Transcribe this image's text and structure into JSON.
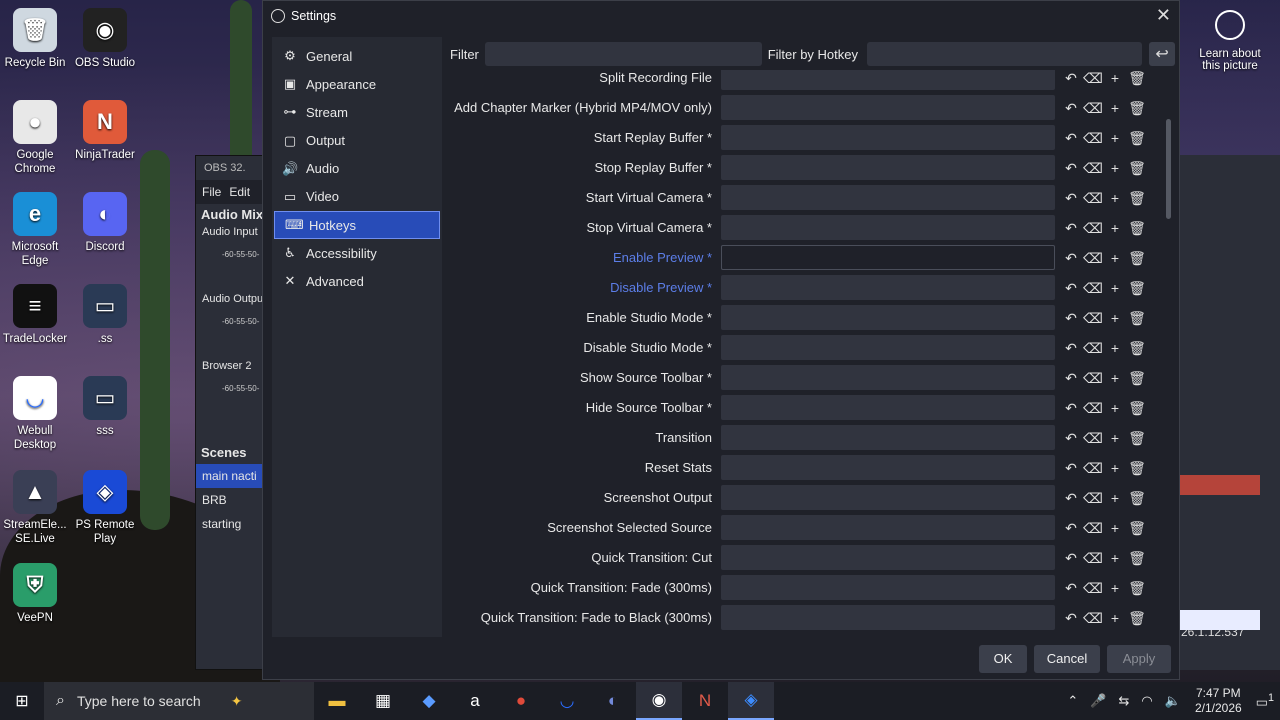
{
  "desktop": {
    "icons": [
      {
        "label": "Recycle Bin",
        "glyph": "🗑"
      },
      {
        "label": "OBS Studio",
        "glyph": "◉"
      },
      {
        "label": "Google Chrome",
        "glyph": "●"
      },
      {
        "label": "NinjaTrader",
        "glyph": "N"
      },
      {
        "label": "Microsoft Edge",
        "glyph": "e"
      },
      {
        "label": "Discord",
        "glyph": "◐"
      },
      {
        "label": "TradeLocker",
        "glyph": "≡"
      },
      {
        "label": ".ss",
        "glyph": "▭"
      },
      {
        "label": "Webull Desktop",
        "glyph": "◡"
      },
      {
        "label": "sss",
        "glyph": "▭"
      },
      {
        "label": "StreamEle... SE.Live",
        "glyph": "▲"
      },
      {
        "label": "PS Remote Play",
        "glyph": "◈"
      },
      {
        "label": "VeePN",
        "glyph": "⛨"
      }
    ],
    "learn_label": "Learn about this picture"
  },
  "obs_main": {
    "title": "OBS 32.",
    "menu": [
      "File",
      "Edit"
    ],
    "audio_mixer_label": "Audio Mix",
    "sources": [
      "Audio Input",
      "Audio Outpu",
      "Browser 2"
    ],
    "meter_ticks": "-60-55-50-",
    "scenes_label": "Scenes",
    "scenes": [
      "main nacti",
      "BRB",
      "starting"
    ],
    "version": "26.1.12.537"
  },
  "settings": {
    "title": "Settings",
    "sidebar": [
      {
        "label": "General",
        "icon": "gear-icon",
        "glyph": "⚙"
      },
      {
        "label": "Appearance",
        "icon": "palette-icon",
        "glyph": "▣"
      },
      {
        "label": "Stream",
        "icon": "antenna-icon",
        "glyph": "⊶"
      },
      {
        "label": "Output",
        "icon": "output-icon",
        "glyph": "▢"
      },
      {
        "label": "Audio",
        "icon": "speaker-icon",
        "glyph": "🔊"
      },
      {
        "label": "Video",
        "icon": "monitor-icon",
        "glyph": "▭"
      },
      {
        "label": "Hotkeys",
        "icon": "keyboard-icon",
        "glyph": "⌨",
        "selected": true
      },
      {
        "label": "Accessibility",
        "icon": "accessibility-icon",
        "glyph": "♿"
      },
      {
        "label": "Advanced",
        "icon": "wrench-icon",
        "glyph": "✕"
      }
    ],
    "filter_label": "Filter",
    "filter_by_hotkey_label": "Filter by Hotkey",
    "hotkeys": [
      {
        "name": "Split Recording File"
      },
      {
        "name": "Add Chapter Marker (Hybrid MP4/MOV only)"
      },
      {
        "name": "Start Replay Buffer *"
      },
      {
        "name": "Stop Replay Buffer *"
      },
      {
        "name": "Start Virtual Camera *"
      },
      {
        "name": "Stop Virtual Camera *"
      },
      {
        "name": "Enable Preview *",
        "highlight": true,
        "focused": true
      },
      {
        "name": "Disable Preview *",
        "highlight": true
      },
      {
        "name": "Enable Studio Mode *"
      },
      {
        "name": "Disable Studio Mode *"
      },
      {
        "name": "Show Source Toolbar *"
      },
      {
        "name": "Hide Source Toolbar *"
      },
      {
        "name": "Transition"
      },
      {
        "name": "Reset Stats"
      },
      {
        "name": "Screenshot Output"
      },
      {
        "name": "Screenshot Selected Source"
      },
      {
        "name": "Quick Transition: Cut"
      },
      {
        "name": "Quick Transition: Fade (300ms)"
      },
      {
        "name": "Quick Transition: Fade to Black (300ms)"
      }
    ],
    "row_buttons": {
      "undo": "↶",
      "clear": "⌫",
      "add": "+",
      "delete": "🗑"
    },
    "buttons": {
      "ok": "OK",
      "cancel": "Cancel",
      "apply": "Apply"
    }
  },
  "taskbar": {
    "search_placeholder": "Type here to search",
    "time": "7:47 PM",
    "date": "2/1/2026",
    "notification_count": "1"
  },
  "colors": {
    "accent": "#284cb8",
    "highlight_text": "#5c7ee8",
    "window_bg": "#1f2129"
  }
}
